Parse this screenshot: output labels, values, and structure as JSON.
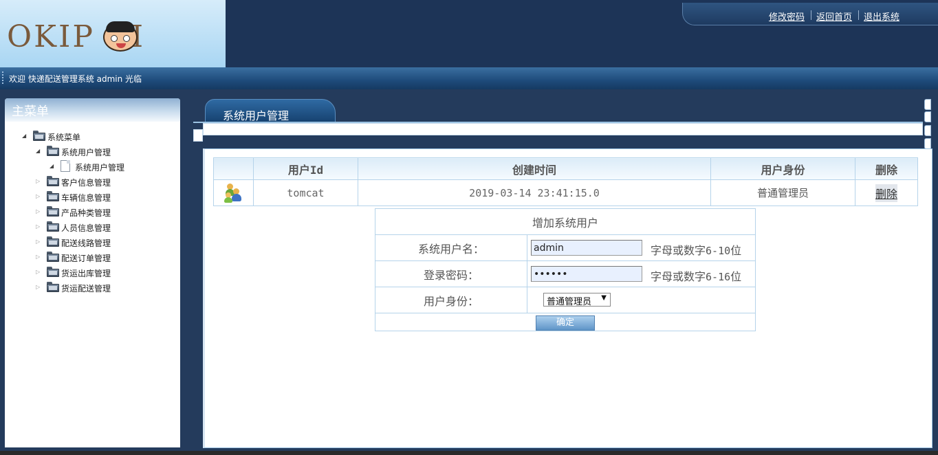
{
  "header": {
    "logo_text": "OKIP KI",
    "links": [
      "修改密码",
      "返回首页",
      "退出系统"
    ]
  },
  "welcome": {
    "text": "欢迎 快递配送管理系统 admin 光临"
  },
  "sidebar": {
    "title": "主菜单",
    "tree": [
      {
        "label": "系统菜单",
        "level": 0,
        "state": "open",
        "icon": "folder-icon"
      },
      {
        "label": "系统用户管理",
        "level": 1,
        "state": "open",
        "icon": "folder-icon"
      },
      {
        "label": "系统用户管理",
        "level": 2,
        "state": "open",
        "icon": "document-icon"
      },
      {
        "label": "客户信息管理",
        "level": 1,
        "state": "closed",
        "icon": "folder-icon"
      },
      {
        "label": "车辆信息管理",
        "level": 1,
        "state": "closed",
        "icon": "folder-icon"
      },
      {
        "label": "产品种类管理",
        "level": 1,
        "state": "closed",
        "icon": "folder-icon"
      },
      {
        "label": "人员信息管理",
        "level": 1,
        "state": "closed",
        "icon": "folder-icon"
      },
      {
        "label": "配送线路管理",
        "level": 1,
        "state": "closed",
        "icon": "folder-icon"
      },
      {
        "label": "配送订单管理",
        "level": 1,
        "state": "closed",
        "icon": "folder-icon"
      },
      {
        "label": "货运出库管理",
        "level": 1,
        "state": "closed",
        "icon": "folder-icon"
      },
      {
        "label": "货运配送管理",
        "level": 1,
        "state": "closed",
        "icon": "folder-icon"
      }
    ]
  },
  "main": {
    "tab_title": "系统用户管理",
    "table": {
      "headers": [
        "",
        "用户Id",
        "创建时间",
        "用户身份",
        "删除"
      ],
      "rows": [
        {
          "icon": "users-icon",
          "user_id": "tomcat",
          "created": "2019-03-14 23:41:15.0",
          "role": "普通管理员",
          "delete": "删除"
        }
      ]
    },
    "form": {
      "caption": "增加系统用户",
      "username_label": "系统用户名：",
      "username_value": "admin",
      "username_hint_text": "字母或数字",
      "username_hint_num": "6-10",
      "username_hint_tail": "位",
      "password_label": "登录密码：",
      "password_value": "123456",
      "password_hint_text": "字母或数字",
      "password_hint_num": "6-16",
      "password_hint_tail": "位",
      "role_label": "用户身份：",
      "role_selected": "普通管理员",
      "submit_label": "确定"
    }
  },
  "colors": {
    "header_bg": "#1d3457",
    "accent": "#2f6aa3",
    "border": "#b5d3ea"
  }
}
